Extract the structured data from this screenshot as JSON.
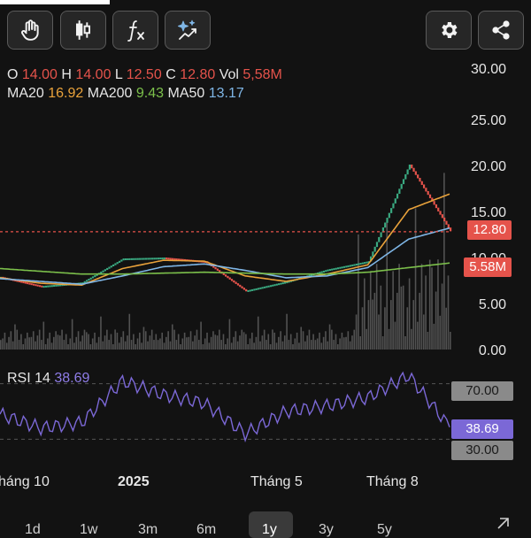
{
  "toolbar": {
    "tools": [
      {
        "name": "drag-hand-icon"
      },
      {
        "name": "candlestick-icon"
      },
      {
        "name": "function-icon"
      },
      {
        "name": "ai-analysis-icon"
      }
    ],
    "right": [
      {
        "name": "settings-icon"
      },
      {
        "name": "share-icon"
      }
    ]
  },
  "ohlc": {
    "o_label": "O",
    "o": "14.00",
    "h_label": "H",
    "h": "14.00",
    "l_label": "L",
    "l": "12.50",
    "c_label": "C",
    "c": "12.80",
    "vol_label": "Vol",
    "vol": "5,58M"
  },
  "ma": {
    "ma20_label": "MA20",
    "ma20": "16.92",
    "ma200_label": "MA200",
    "ma200": "9.43",
    "ma50_label": "MA50",
    "ma50": "13.17"
  },
  "price_axis": [
    "30.00",
    "25.00",
    "20.00",
    "15.00",
    "10.00",
    "5.00",
    "0.00"
  ],
  "price_tags": {
    "last_price": "12.80",
    "volume": "5.58M"
  },
  "rsi": {
    "title_label": "RSI 14",
    "value": "38.69",
    "upper": "70.00",
    "lower": "30.00"
  },
  "x_axis": [
    "háng 10",
    "2025",
    "Tháng 5",
    "Tháng 8"
  ],
  "timeframes": [
    "1d",
    "1w",
    "3m",
    "6m",
    "1y",
    "3y",
    "5y"
  ],
  "active_timeframe": "1y",
  "colors": {
    "up": "#3aa981",
    "down": "#e5534b",
    "ma20": "#e9a23b",
    "ma50": "#7fb6e6",
    "ma200": "#7cc04b",
    "rsi": "#7b68d6",
    "volume": "#5a5a5a"
  },
  "chart_data": {
    "type": "line",
    "x": [
      "2024-10",
      "2024-11",
      "2024-12",
      "2025-01",
      "2025-02",
      "2025-03",
      "2025-04",
      "2025-05",
      "2025-06",
      "2025-07",
      "2025-08",
      "2025-09"
    ],
    "ylim": [
      0,
      30
    ],
    "series": [
      {
        "name": "Close",
        "values": [
          7.8,
          6.8,
          7.2,
          9.8,
          9.9,
          9.5,
          6.3,
          7.3,
          8.6,
          9.5,
          20.0,
          12.8
        ]
      },
      {
        "name": "MA20",
        "values": [
          7.8,
          7.2,
          7.0,
          8.8,
          9.7,
          9.6,
          8.0,
          7.4,
          8.2,
          9.2,
          15.2,
          16.9
        ]
      },
      {
        "name": "MA50",
        "values": [
          7.7,
          7.4,
          7.1,
          8.0,
          9.0,
          9.3,
          8.6,
          7.8,
          8.0,
          8.9,
          12.0,
          13.2
        ]
      },
      {
        "name": "MA200",
        "values": [
          8.8,
          8.5,
          8.2,
          8.2,
          8.3,
          8.4,
          8.3,
          8.2,
          8.2,
          8.4,
          8.9,
          9.4
        ]
      }
    ],
    "rsi_values": [
      48,
      38,
      42,
      72,
      62,
      56,
      34,
      50,
      54,
      60,
      76,
      38.69
    ]
  }
}
